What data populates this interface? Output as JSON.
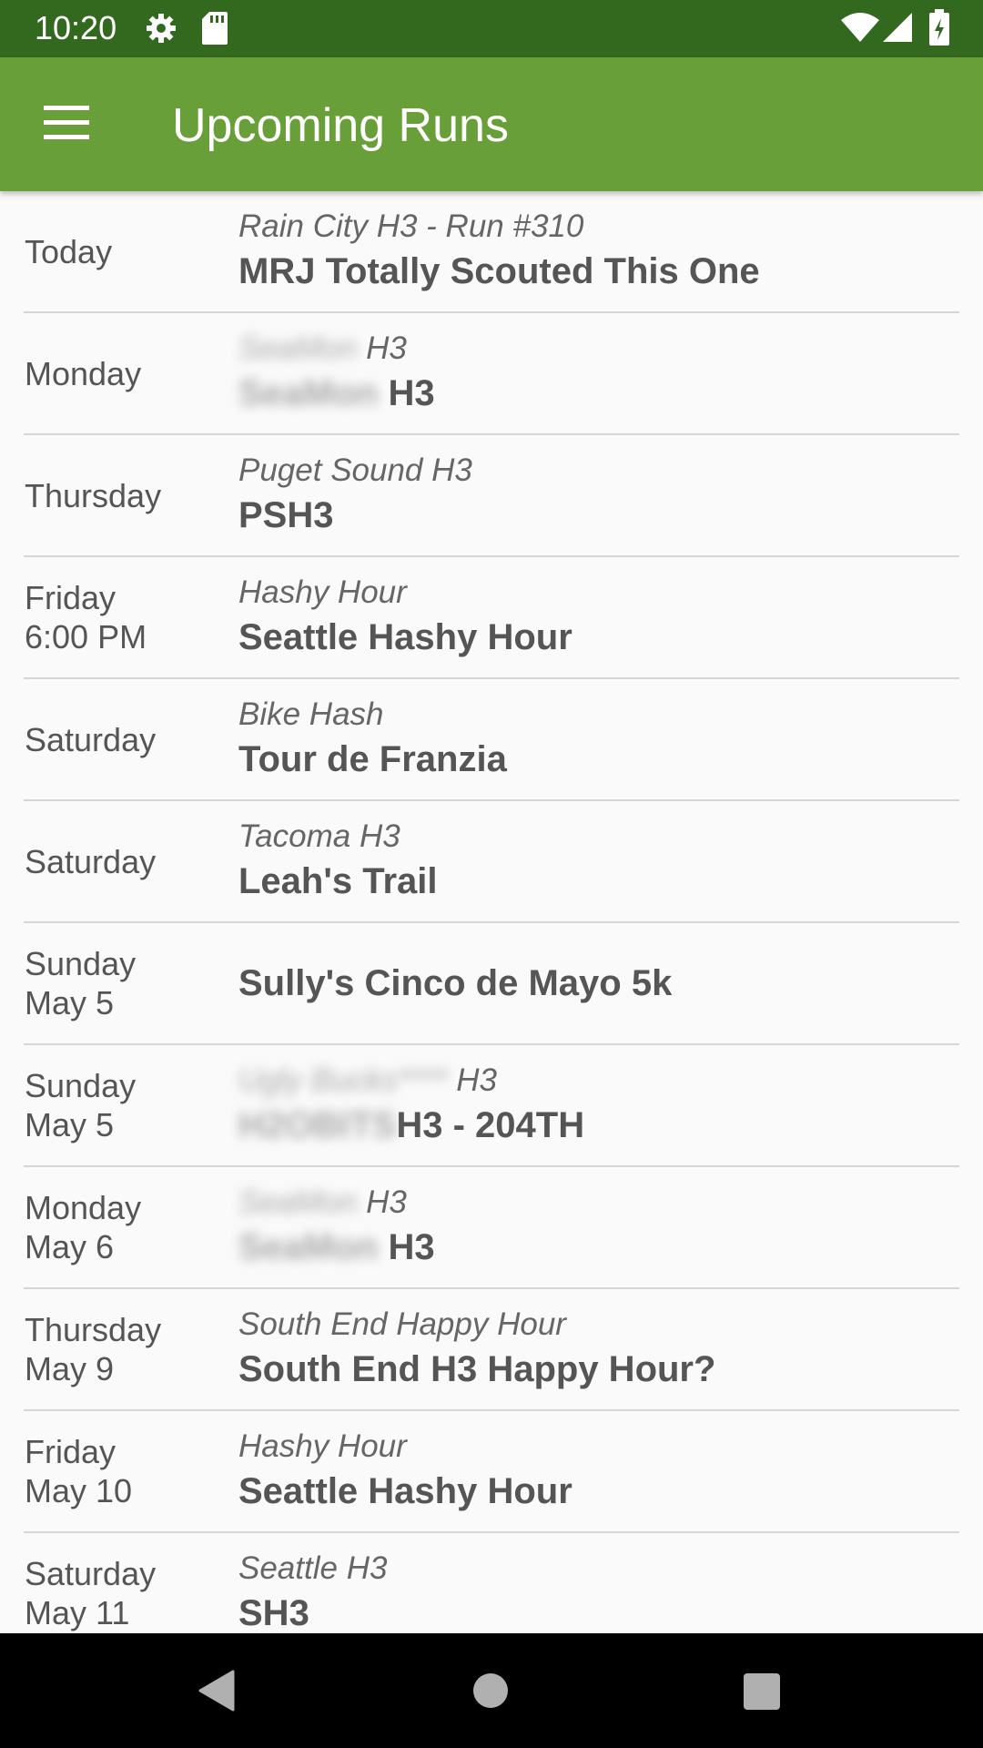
{
  "status_bar": {
    "time": "10:20",
    "icons": [
      "settings-icon",
      "sd-card-icon",
      "wifi-icon",
      "signal-icon",
      "battery-charging-icon"
    ]
  },
  "app_bar": {
    "menu_icon": "hamburger-menu-icon",
    "title": "Upcoming Runs"
  },
  "runs": [
    {
      "day": "Today",
      "kennel": "Rain City H3  - Run #310",
      "title": "MRJ Totally Scouted This One"
    },
    {
      "day": "Monday",
      "kennel_hidden": "SeaMon",
      "kennel": "H3",
      "title_hidden": "SeaMon",
      "title": "H3"
    },
    {
      "day": "Thursday",
      "kennel": "Puget Sound H3",
      "title": "PSH3"
    },
    {
      "day": "Friday\n6:00 PM",
      "kennel": "Hashy Hour",
      "title": "Seattle Hashy Hour"
    },
    {
      "day": "Saturday",
      "kennel": "Bike Hash",
      "title": "Tour de Franzia"
    },
    {
      "day": "Saturday",
      "kennel": "Tacoma H3",
      "title": "Leah's Trail"
    },
    {
      "day": "Sunday\nMay 5",
      "kennel": "",
      "title": "Sully's Cinco de Mayo 5k"
    },
    {
      "day": "Sunday\nMay 5",
      "kennel_hidden": "Ugly Bucks****",
      "kennel": "H3",
      "title_hidden": "H2OBITS",
      "title": "H3 - 204TH"
    },
    {
      "day": "Monday\nMay 6",
      "kennel_hidden": "SeaMon",
      "kennel": "H3",
      "title_hidden": "SeaMon",
      "title": "H3"
    },
    {
      "day": "Thursday\nMay 9",
      "kennel": "South End Happy Hour",
      "title": "South End H3 Happy Hour?"
    },
    {
      "day": "Friday\nMay 10",
      "kennel": "Hashy Hour",
      "title": "Seattle Hashy Hour"
    },
    {
      "day": "Saturday\nMay 11",
      "kennel": "Seattle H3",
      "title": "SH3"
    }
  ],
  "nav_bar": {
    "buttons": [
      "back-icon",
      "home-icon",
      "recents-icon"
    ]
  },
  "colors": {
    "status_bar": "#33691e",
    "app_bar": "#689f38",
    "background": "#fafafa",
    "divider": "#d6d6d6"
  }
}
